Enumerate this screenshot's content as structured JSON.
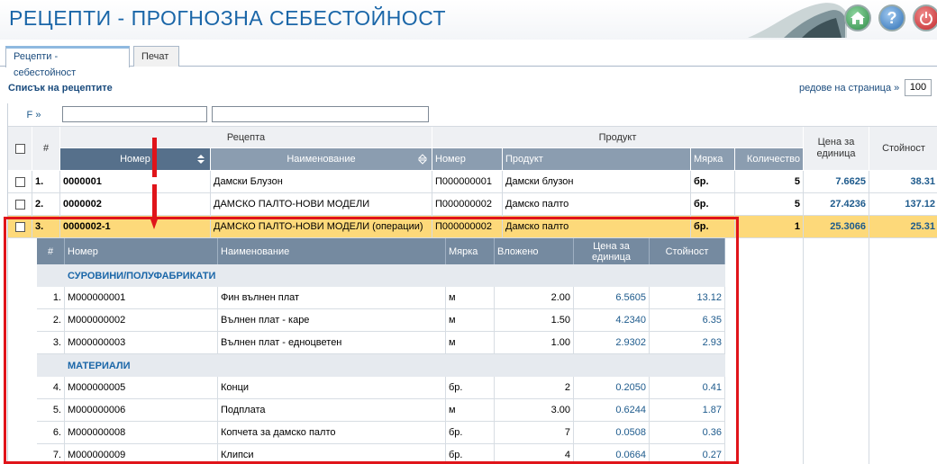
{
  "app": {
    "title": "РЕЦЕПТИ - ПРОГНОЗНА СЕБЕСТОЙНОСТ",
    "buttons": [
      "home-icon",
      "help-icon",
      "power-icon"
    ],
    "help_label": "?"
  },
  "tabs": [
    {
      "label": "Рецепти - себестойност",
      "active": true
    },
    {
      "label": "Печат",
      "active": false
    }
  ],
  "list": {
    "title": "Списък на рецептите",
    "rows_per_page_label": "редове на страница »",
    "rows_per_page": "100"
  },
  "filter": {
    "label": "F »"
  },
  "columns": {
    "hash": "#",
    "recipe_group": "Рецепта",
    "product_group": "Продукт",
    "number": "Номер",
    "name": "Наименование",
    "prod_number": "Номер",
    "product": "Продукт",
    "unit": "Мярка",
    "qty": "Количество",
    "unit_price": "Цена за единица",
    "value": "Стойност"
  },
  "rows": [
    {
      "idx": "1.",
      "number": "0000001",
      "name": "Дамски Блузон",
      "prod_number": "П000000001",
      "product": "Дамски блузон",
      "unit": "бр.",
      "qty": "5",
      "unit_price": "7.6625",
      "value": "38.31"
    },
    {
      "idx": "2.",
      "number": "0000002",
      "name": "ДАМСКО ПАЛТО-НОВИ МОДЕЛИ",
      "prod_number": "П000000002",
      "product": "Дамско палто",
      "unit": "бр.",
      "qty": "5",
      "unit_price": "27.4236",
      "value": "137.12"
    },
    {
      "idx": "3.",
      "number": "0000002-1",
      "name": "ДАМСКО ПАЛТО-НОВИ МОДЕЛИ (операции)",
      "prod_number": "П000000002",
      "product": "Дамско палто",
      "unit": "бр.",
      "qty": "1",
      "unit_price": "25.3066",
      "value": "25.31"
    }
  ],
  "details": {
    "columns": {
      "hash": "#",
      "number": "Номер",
      "name": "Наименование",
      "unit": "Мярка",
      "embedded": "Вложено",
      "unit_price": "Цена за единица",
      "value": "Стойност"
    },
    "sections": [
      {
        "title": "СУРОВИНИ/ПОЛУФАБРИКАТИ",
        "rows": [
          {
            "idx": "1.",
            "number": "M000000001",
            "name": "Фин вълнен плат",
            "unit": "м",
            "embedded": "2.00",
            "unit_price": "6.5605",
            "value": "13.12"
          },
          {
            "idx": "2.",
            "number": "M000000002",
            "name": "Вълнен плат - каре",
            "unit": "м",
            "embedded": "1.50",
            "unit_price": "4.2340",
            "value": "6.35"
          },
          {
            "idx": "3.",
            "number": "M000000003",
            "name": "Вълнен плат - едноцветен",
            "unit": "м",
            "embedded": "1.00",
            "unit_price": "2.9302",
            "value": "2.93"
          }
        ]
      },
      {
        "title": "МАТЕРИАЛИ",
        "rows": [
          {
            "idx": "4.",
            "number": "M000000005",
            "name": "Конци",
            "unit": "бр.",
            "embedded": "2",
            "unit_price": "0.2050",
            "value": "0.41"
          },
          {
            "idx": "5.",
            "number": "M000000006",
            "name": "Подплата",
            "unit": "м",
            "embedded": "3.00",
            "unit_price": "0.6244",
            "value": "1.87"
          },
          {
            "idx": "6.",
            "number": "M000000008",
            "name": "Копчета за дамско палто",
            "unit": "бр.",
            "embedded": "7",
            "unit_price": "0.0508",
            "value": "0.36"
          },
          {
            "idx": "7.",
            "number": "M000000009",
            "name": "Клипси",
            "unit": "бр.",
            "embedded": "4",
            "unit_price": "0.0664",
            "value": "0.27"
          }
        ]
      }
    ]
  },
  "colors": {
    "title": "#1a66a8",
    "highlight_row": "#fdd97a",
    "annotation": "#e0141a",
    "link": "#1d5a8c"
  }
}
